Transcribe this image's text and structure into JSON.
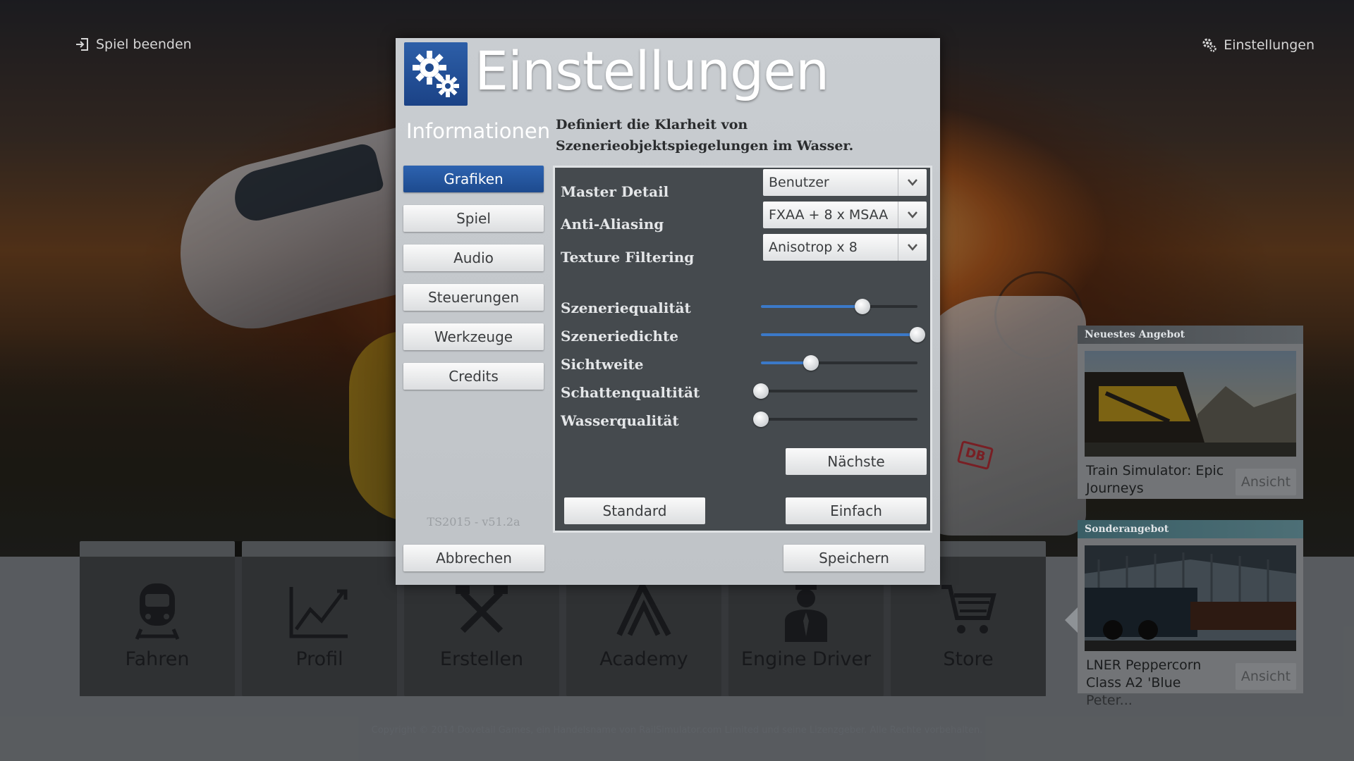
{
  "top": {
    "quit_label": "Spiel beenden",
    "settings_label": "Einstellungen"
  },
  "dialog": {
    "title": "Einstellungen",
    "section": "Informationen",
    "description": "Definiert die Klarheit von Szenerieobjektspiegelungen im Wasser.",
    "nav": [
      {
        "label": "Grafiken",
        "active": true
      },
      {
        "label": "Spiel"
      },
      {
        "label": "Audio"
      },
      {
        "label": "Steuerungen"
      },
      {
        "label": "Werkzeuge"
      },
      {
        "label": "Credits"
      }
    ],
    "version": "TS2015 - v51.2a",
    "dropdowns": [
      {
        "label": "Master Detail",
        "value": "Benutzer"
      },
      {
        "label": "Anti-Aliasing",
        "value": "FXAA + 8 x MSAA"
      },
      {
        "label": "Texture Filtering",
        "value": "Anisotrop x 8"
      }
    ],
    "sliders": [
      {
        "label": "Szeneriequalität",
        "value": 0.65
      },
      {
        "label": "Szeneriedichte",
        "value": 1.0
      },
      {
        "label": "Sichtweite",
        "value": 0.32
      },
      {
        "label": "Schattenqualtität",
        "value": 0.0
      },
      {
        "label": "Wasserqualität",
        "value": 0.0
      }
    ],
    "next_label": "Nächste",
    "standard_label": "Standard",
    "simple_label": "Einfach",
    "cancel_label": "Abbrechen",
    "save_label": "Speichern"
  },
  "tiles": [
    {
      "label": "Fahren",
      "icon": "train-icon"
    },
    {
      "label": "Profil",
      "icon": "chart-icon"
    },
    {
      "label": "Erstellen",
      "icon": "tools-icon"
    },
    {
      "label": "Academy",
      "icon": "academy-icon"
    },
    {
      "label": "Engine Driver",
      "icon": "driver-icon"
    },
    {
      "label": "Store",
      "icon": "cart-icon"
    }
  ],
  "offers": {
    "newest": {
      "heading": "Neuestes Angebot",
      "title": "Train Simulator: Epic Journeys",
      "button": "Ansicht"
    },
    "special": {
      "heading": "Sonderangebot",
      "title": "LNER Peppercorn Class A2 'Blue Peter...",
      "button": "Ansicht"
    }
  },
  "copyright": "Copyright © 2014 Dovetail Games, ein Handelsname von RailSimulator.com Limited und seine Lizenzgeber. Alle Rechte vorbehalten.",
  "colors": {
    "accent_blue": "#1d4a8e",
    "slider_fill": "#3b79c8",
    "panel_dark": "#454a4e"
  }
}
